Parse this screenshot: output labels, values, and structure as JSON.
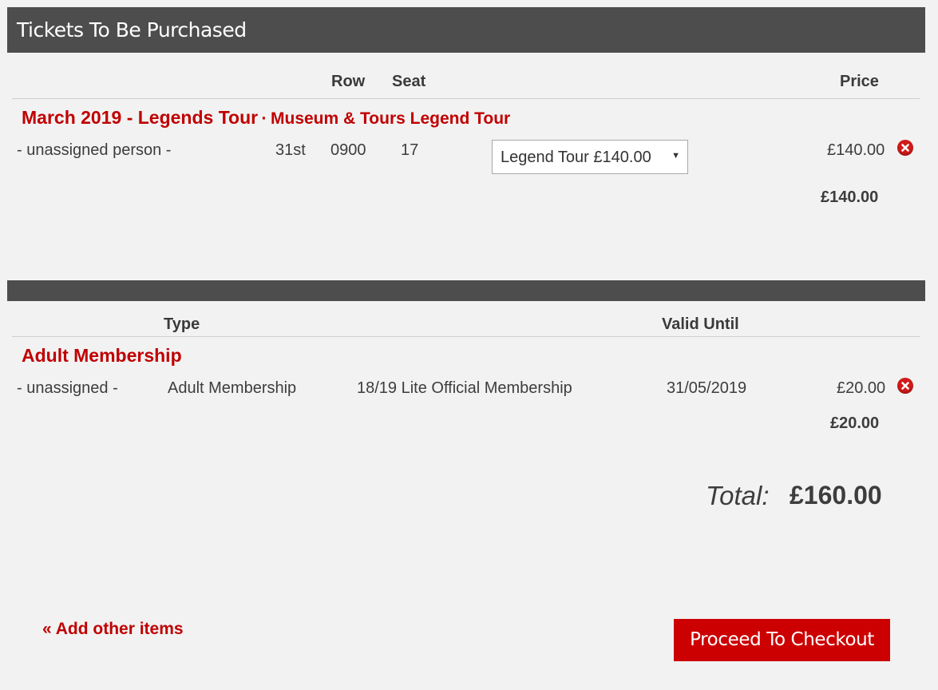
{
  "section_tickets": {
    "title": "Tickets To Be Purchased",
    "headers": {
      "row": "Row",
      "seat": "Seat",
      "price": "Price"
    },
    "event_title": "March 2019 - Legends Tour",
    "event_separator": "·",
    "event_subtitle": "Museum & Tours Legend Tour",
    "item": {
      "person": "- unassigned person -",
      "date": "31st",
      "row": "0900",
      "seat": "17",
      "ticket_type": "Legend Tour £140.00",
      "price": "£140.00"
    },
    "subtotal": "£140.00"
  },
  "section_membership": {
    "headers": {
      "type": "Type",
      "valid_until": "Valid Until"
    },
    "title": "Adult Membership",
    "item": {
      "person": "- unassigned -",
      "type": "Adult Membership",
      "product": "18/19 Lite Official Membership",
      "valid_until": "31/05/2019",
      "price": "£20.00"
    },
    "subtotal": "£20.00"
  },
  "total": {
    "label": "Total:",
    "value": "£160.00"
  },
  "actions": {
    "add_items": "« Add other items",
    "checkout": "Proceed To Checkout"
  },
  "icons": {
    "remove": "remove-circle-icon",
    "dropdown": "chevron-down-icon"
  },
  "colors": {
    "accent": "#c00000",
    "header_bar": "#4d4d4d",
    "button": "#cc0000"
  }
}
